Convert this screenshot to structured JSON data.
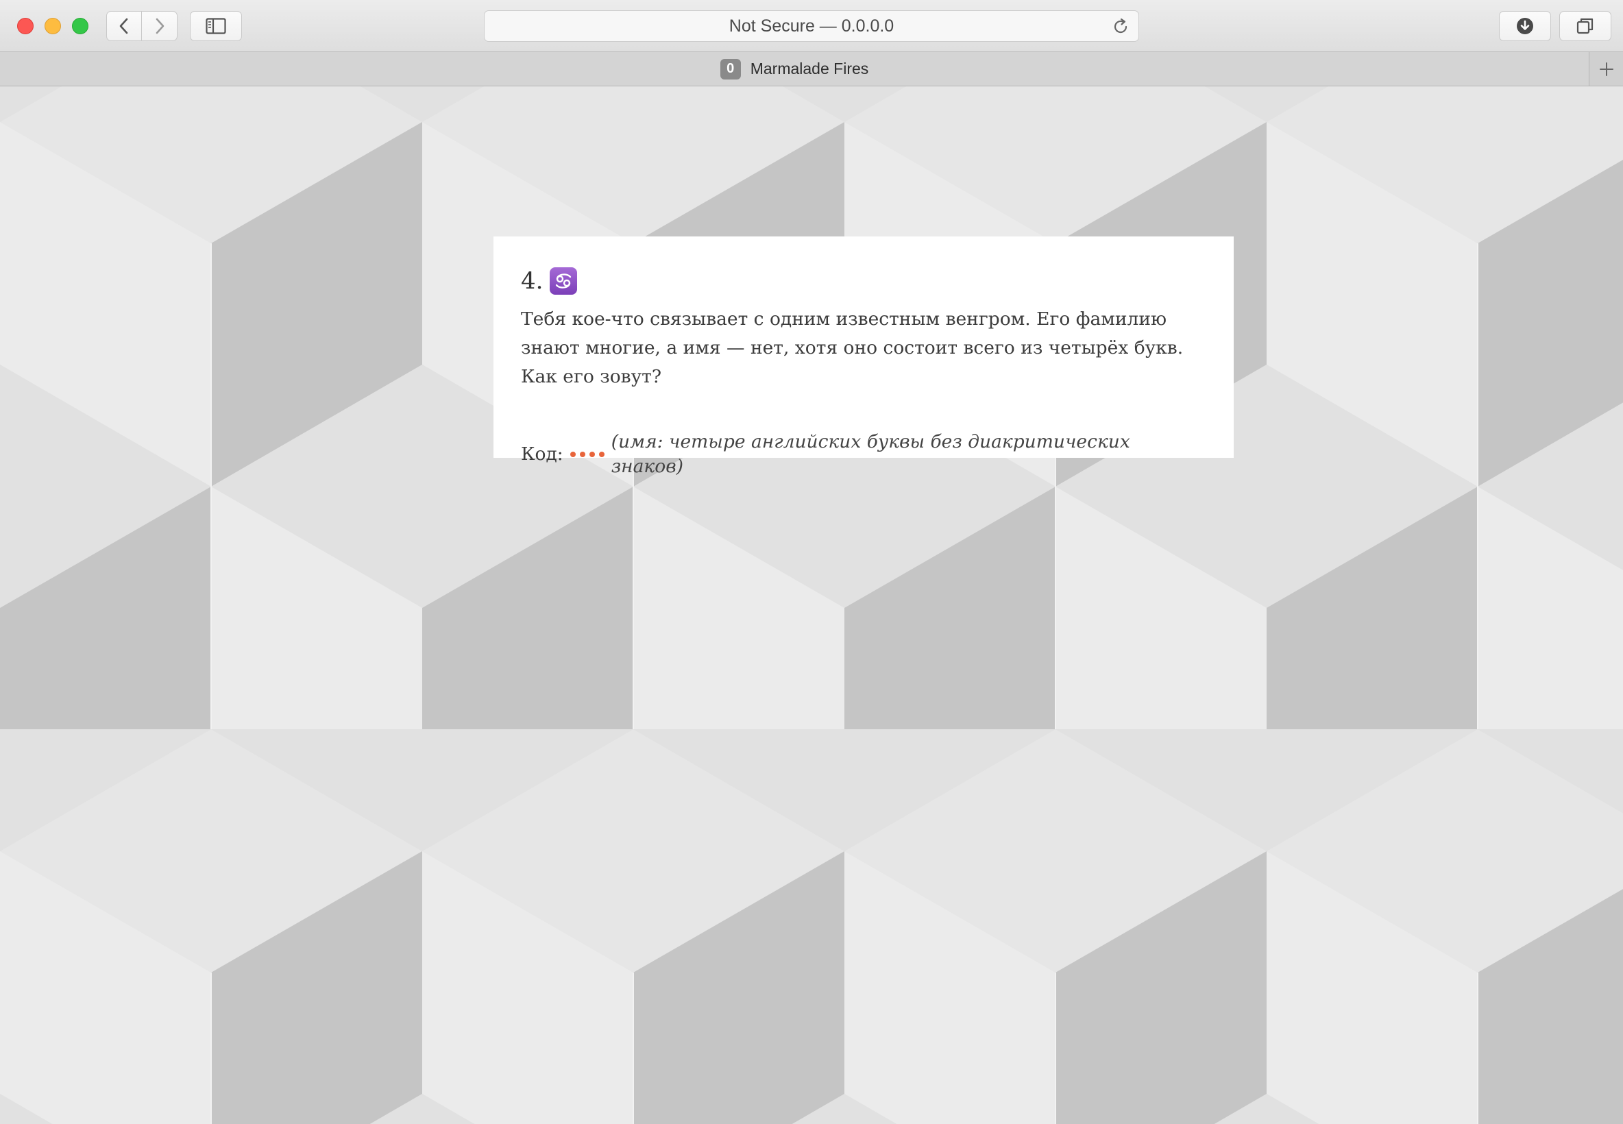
{
  "browser": {
    "address_text": "Not Secure — 0.0.0.0",
    "tab": {
      "badge": "0",
      "title": "Marmalade Fires"
    },
    "icons": {
      "back": "chevron-left-icon",
      "forward": "chevron-right-icon",
      "sidebar": "sidebar-icon",
      "reload": "reload-icon",
      "downloads": "download-icon",
      "tabs": "tabs-overview-icon",
      "new_tab": "plus-icon"
    }
  },
  "question": {
    "number": "4.",
    "icon": "cancer-zodiac-icon",
    "text": "Тебя кое-что связывает с одним известным венгром. Его фамилию знают многие, а имя — нет, хотя оно состоит всего из четырёх букв. Как его зовут?",
    "code_label": "Код:",
    "code_length": 4,
    "code_hint": "(имя: четыре английских буквы без диакритических знаков)"
  },
  "colors": {
    "accent_dots": "#e8643a",
    "zodiac_bg": "#8e4fc4"
  }
}
